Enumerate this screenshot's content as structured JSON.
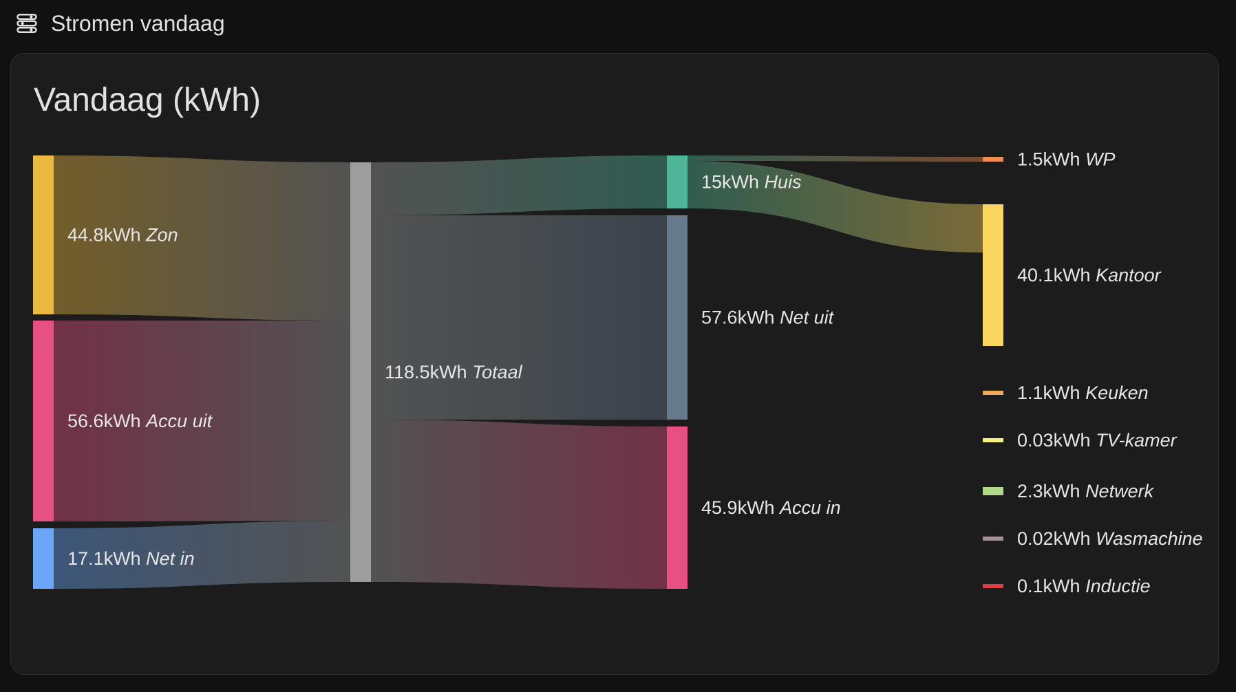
{
  "header": {
    "title": "Stromen vandaag",
    "icon": "flows-icon"
  },
  "card": {
    "title": "Vandaag (kWh)"
  },
  "unit": "kWh",
  "nodes": [
    {
      "id": "zon",
      "column": 0,
      "value": "44.8",
      "name": "Zon",
      "color": "#eab93e"
    },
    {
      "id": "accu_uit",
      "column": 0,
      "value": "56.6",
      "name": "Accu uit",
      "color": "#e84f82"
    },
    {
      "id": "net_in",
      "column": 0,
      "value": "17.1",
      "name": "Net in",
      "color": "#6aa7f8"
    },
    {
      "id": "totaal",
      "column": 1,
      "value": "118.5",
      "name": "Totaal",
      "color": "#9e9e9e"
    },
    {
      "id": "huis",
      "column": 2,
      "value": "15",
      "name": "Huis",
      "color": "#4db598"
    },
    {
      "id": "net_uit",
      "column": 2,
      "value": "57.6",
      "name": "Net uit",
      "color": "#657b8c"
    },
    {
      "id": "accu_in",
      "column": 2,
      "value": "45.9",
      "name": "Accu in",
      "color": "#e84f82"
    },
    {
      "id": "wp",
      "column": 3,
      "value": "1.5",
      "name": "WP",
      "color": "#ef8b4f"
    },
    {
      "id": "kantoor",
      "column": 3,
      "value": "40.1",
      "name": "Kantoor",
      "color": "#fbd65e"
    },
    {
      "id": "keuken",
      "column": 3,
      "value": "1.1",
      "name": "Keuken",
      "color": "#f0ab5a"
    },
    {
      "id": "tvkamer",
      "column": 3,
      "value": "0.03",
      "name": "TV-kamer",
      "color": "#f5f07c"
    },
    {
      "id": "netwerk",
      "column": 3,
      "value": "2.3",
      "name": "Netwerk",
      "color": "#b2d88a"
    },
    {
      "id": "wasmachine",
      "column": 3,
      "value": "0.02",
      "name": "Wasmachine",
      "color": "#a69292"
    },
    {
      "id": "inductie",
      "column": 3,
      "value": "0.1",
      "name": "Inductie",
      "color": "#d64040"
    }
  ],
  "links": [
    {
      "source": "zon",
      "target": "totaal",
      "value": 44.8
    },
    {
      "source": "accu_uit",
      "target": "totaal",
      "value": 56.6
    },
    {
      "source": "net_in",
      "target": "totaal",
      "value": 17.1
    },
    {
      "source": "totaal",
      "target": "huis",
      "value": 15
    },
    {
      "source": "totaal",
      "target": "net_uit",
      "value": 57.6
    },
    {
      "source": "totaal",
      "target": "accu_in",
      "value": 45.9
    },
    {
      "source": "huis",
      "target": "wp",
      "value": 1.5
    },
    {
      "source": "huis",
      "target": "kantoor",
      "value": 40.1
    }
  ]
}
